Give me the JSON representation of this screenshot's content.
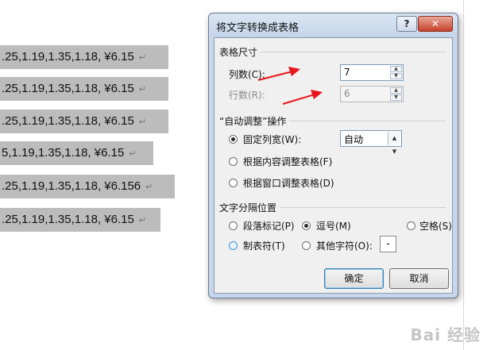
{
  "document": {
    "lines": [
      ".25,1.19,1.35,1.18, ¥6.15",
      ".25,1.19,1.35,1.18, ¥6.15",
      ".25,1.19,1.35,1.18, ¥6.15",
      "5,1.19,1.35,1.18, ¥6.15",
      ".25,1.19,1.35,1.18, ¥6.156",
      ".25,1.19,1.35,1.18, ¥6.15"
    ],
    "paragraph_mark": "↵"
  },
  "dialog": {
    "title": "将文字转换成表格",
    "help_label": "?",
    "close_label": "✕",
    "table_size": {
      "group_label": "表格尺寸",
      "columns_label": "列数(C):",
      "columns_value": "7",
      "rows_label": "行数(R):",
      "rows_value": "6"
    },
    "autofit": {
      "group_label": "“自动调整”操作",
      "fixed_width_label": "固定列宽(W):",
      "fixed_width_value": "自动",
      "fit_content_label": "根据内容调整表格(F)",
      "fit_window_label": "根据窗口调整表格(D)"
    },
    "separator": {
      "group_label": "文字分隔位置",
      "paragraph_label": "段落标记(P)",
      "comma_label": "逗号(M)",
      "space_label": "空格(S)",
      "tab_label": "制表符(T)",
      "other_label": "其他字符(O):",
      "other_value": "-"
    },
    "ok_label": "确定",
    "cancel_label": "取消"
  },
  "watermark": "Bai 经验",
  "colors": {
    "arrow": "#e8141b",
    "selection": "#bcbcbc",
    "dialog_frame": "#c7d6ea"
  }
}
